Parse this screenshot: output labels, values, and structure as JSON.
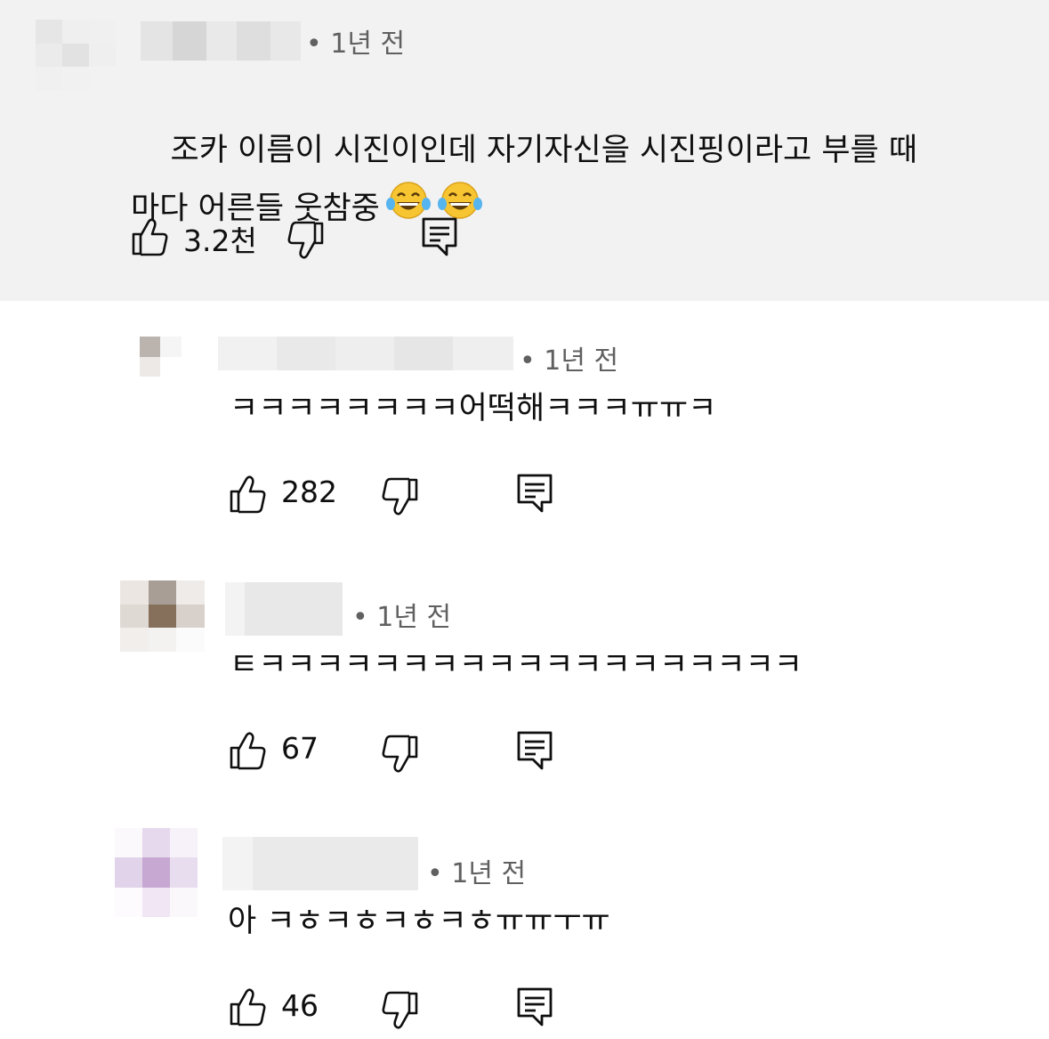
{
  "comments": [
    {
      "time": "• 1년 전",
      "text_line1": "조카 이름이 시진이인데 자기자신을 시진핑이라고 부를 때",
      "text_line2": "마다 어른들 웃참중",
      "emoji": "face-with-tears-of-joy",
      "likes": "3.2천"
    },
    {
      "time": "• 1년 전",
      "text": "ㅋㅋㅋㅋㅋㅋㅋㅋ어떡해ㅋㅋㅋㅠㅠㅋ",
      "likes": "282"
    },
    {
      "time": "• 1년 전",
      "text": "ㅌㅋㅋㅋㅋㅋㅋㅋㅋㅋㅋㅋㅋㅋㅋㅋㅋㅋㅋㅋ",
      "likes": "67"
    },
    {
      "time": "• 1년 전",
      "text": "아 ㅋㅎㅋㅎㅋㅎㅋㅎㅠㅠㅜㅠ",
      "likes": "46"
    }
  ]
}
